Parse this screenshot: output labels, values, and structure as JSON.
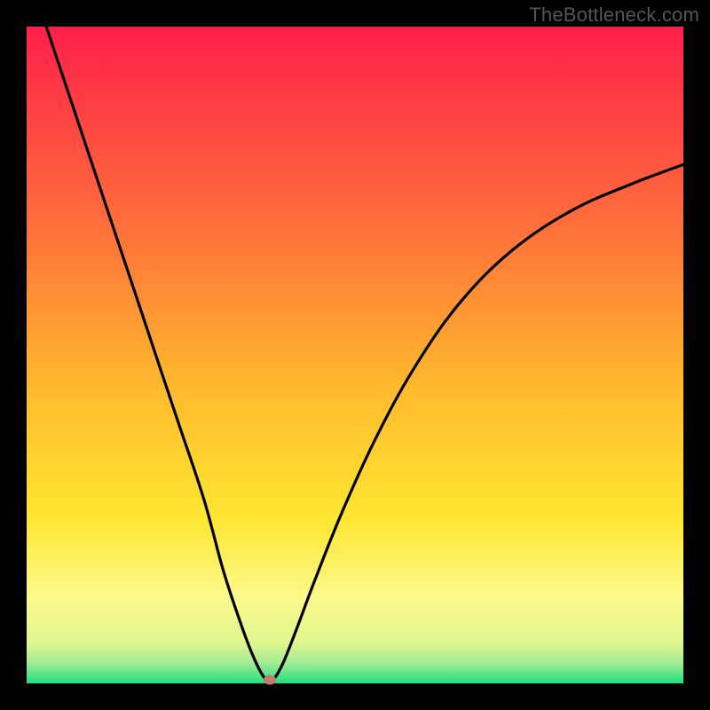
{
  "watermark": "TheBottleneck.com",
  "chart_data": {
    "type": "line",
    "title": "",
    "xlabel": "",
    "ylabel": "",
    "xlim": [
      0,
      100
    ],
    "ylim": [
      0,
      100
    ],
    "background_gradient_stops": [
      {
        "pct": 0,
        "color": "#ff1f4a"
      },
      {
        "pct": 30,
        "color": "#ff6e3b"
      },
      {
        "pct": 55,
        "color": "#ffba2e"
      },
      {
        "pct": 75,
        "color": "#ffe631"
      },
      {
        "pct": 87,
        "color": "#fbf98d"
      },
      {
        "pct": 94,
        "color": "#dff68e"
      },
      {
        "pct": 97,
        "color": "#9eeb95"
      },
      {
        "pct": 100,
        "color": "#1fe07e"
      }
    ],
    "series": [
      {
        "name": "bottleneck-curve",
        "x": [
          3,
          7,
          11,
          15,
          19,
          23,
          27,
          30,
          33,
          35,
          36.5,
          37.5,
          39,
          41,
          44,
          48,
          53,
          59,
          66,
          74,
          83,
          92,
          100
        ],
        "y": [
          100,
          88,
          76,
          64,
          52,
          40,
          28,
          17,
          8,
          3,
          0.5,
          0.5,
          3,
          8,
          16,
          26,
          37,
          48,
          58,
          66,
          72,
          76,
          79
        ]
      }
    ],
    "marker": {
      "x": 37,
      "y": 0.5,
      "color": "#c77a6f"
    }
  }
}
